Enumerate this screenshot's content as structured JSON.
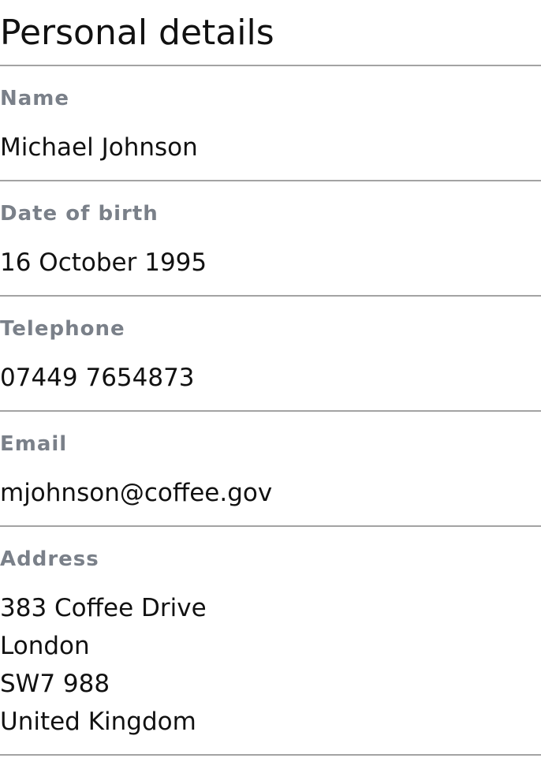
{
  "page": {
    "title": "Personal details"
  },
  "details": {
    "name": {
      "label": "Name",
      "value": "Michael Johnson"
    },
    "dob": {
      "label": "Date of birth",
      "value": "16 October 1995"
    },
    "telephone": {
      "label": "Telephone",
      "value": "07449 7654873"
    },
    "email": {
      "label": "Email",
      "value": "mjohnson@coffee.gov"
    },
    "address": {
      "label": "Address",
      "lines": [
        "383 Coffee Drive",
        "London",
        "SW7 988",
        "United Kingdom"
      ]
    }
  },
  "colors": {
    "label": "#7a8089",
    "text": "#111111",
    "divider": "#a3a3a3"
  }
}
